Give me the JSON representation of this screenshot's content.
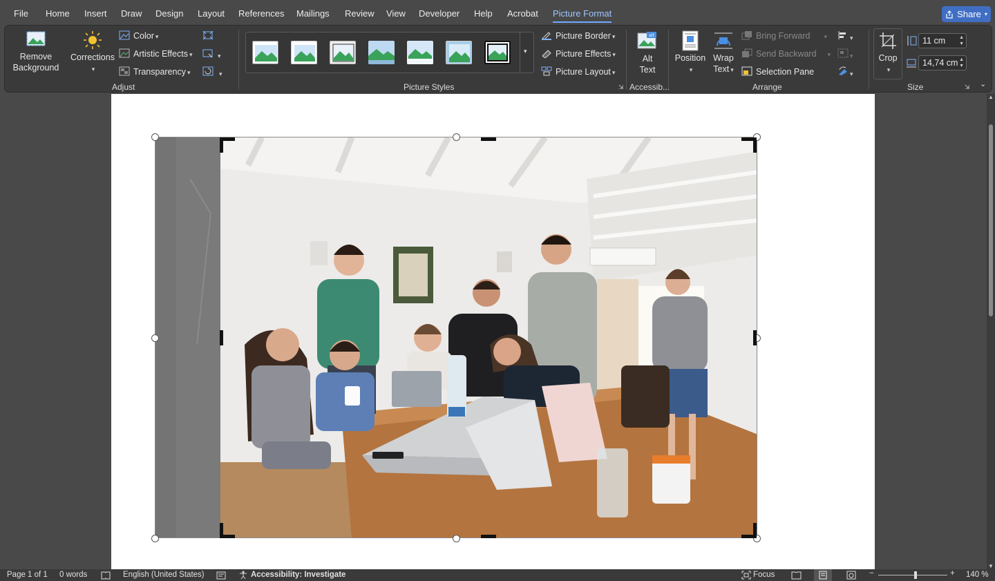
{
  "tabs": [
    {
      "label": "File"
    },
    {
      "label": "Home"
    },
    {
      "label": "Insert"
    },
    {
      "label": "Draw"
    },
    {
      "label": "Design"
    },
    {
      "label": "Layout"
    },
    {
      "label": "References"
    },
    {
      "label": "Mailings"
    },
    {
      "label": "Review"
    },
    {
      "label": "View"
    },
    {
      "label": "Developer"
    },
    {
      "label": "Help"
    },
    {
      "label": "Acrobat"
    },
    {
      "label": "Picture Format"
    }
  ],
  "active_tab": "Picture Format",
  "share": {
    "label": "Share"
  },
  "ribbon": {
    "adjust": {
      "remove_background": "Remove\nBackground",
      "corrections": "Corrections",
      "color": "Color",
      "artistic_effects": "Artistic Effects",
      "transparency": "Transparency",
      "label": "Adjust"
    },
    "picture_styles": {
      "label": "Picture Styles",
      "picture_border": "Picture Border",
      "picture_effects": "Picture Effects",
      "picture_layout": "Picture Layout",
      "style_count": 7
    },
    "accessibility": {
      "alt_text_line1": "Alt",
      "alt_text_line2": "Text",
      "label": "Accessib..."
    },
    "arrange": {
      "position": "Position",
      "wrap_text_line1": "Wrap",
      "wrap_text_line2": "Text",
      "bring_forward": "Bring Forward",
      "send_backward": "Send Backward",
      "selection_pane": "Selection Pane",
      "label": "Arrange"
    },
    "size": {
      "crop": "Crop",
      "height": "11 cm",
      "width": "14,74 cm",
      "label": "Size"
    }
  },
  "status": {
    "page": "Page 1 of 1",
    "words": "0 words",
    "language": "English (United States)",
    "accessibility": "Accessibility: Investigate",
    "focus": "Focus",
    "zoom": "140 %"
  },
  "colors": {
    "accent": "#9fc6ff",
    "share_bg": "#3f6ec3",
    "ribbon_bg": "#3a3a3a",
    "app_bg": "#494949"
  }
}
